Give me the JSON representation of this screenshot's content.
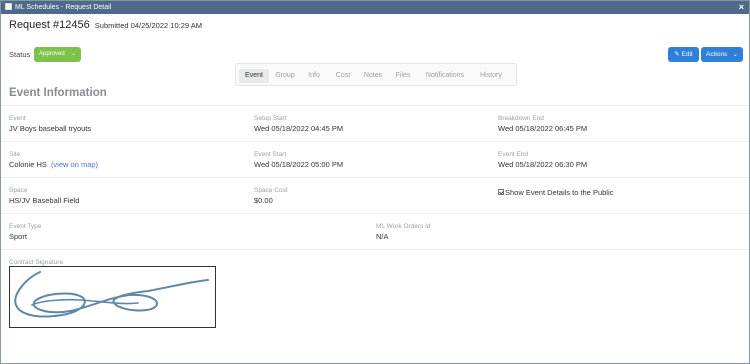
{
  "window": {
    "title": "ML Schedules - Request Detail",
    "close_label": "×"
  },
  "request": {
    "label": "Request #12456",
    "submitted": "Submitted 04/25/2022 10:29 AM"
  },
  "status": {
    "label": "Status",
    "value": "Approved",
    "color": "#7dc24b"
  },
  "actions": {
    "edit_label": "Edit",
    "actions_label": "Actions",
    "accent": "#2f80d8"
  },
  "tabs": [
    {
      "label": "Event",
      "active": true
    },
    {
      "label": "Group",
      "active": false
    },
    {
      "label": "Info",
      "active": false
    },
    {
      "label": "Cost",
      "active": false
    },
    {
      "label": "Notes",
      "active": false
    },
    {
      "label": "Files",
      "active": false
    },
    {
      "label": "Notifications",
      "active": false
    },
    {
      "label": "History",
      "active": false
    }
  ],
  "section": {
    "title": "Event Information"
  },
  "fields": {
    "event": {
      "label": "Event",
      "value": "JV Boys baseball tryouts"
    },
    "setup_start": {
      "label": "Setup Start",
      "value": "Wed 05/18/2022 04:45 PM"
    },
    "breakdown_end": {
      "label": "Breakdown End",
      "value": "Wed 05/18/2022 06:45 PM"
    },
    "site": {
      "label": "Site",
      "value": "Colonie HS",
      "link": "(view on map)"
    },
    "event_start": {
      "label": "Event Start",
      "value": "Wed 05/18/2022 05:00 PM"
    },
    "event_end": {
      "label": "Event End",
      "value": "Wed 05/18/2022 06:30 PM"
    },
    "space": {
      "label": "Space",
      "value": "HS/JV Baseball Field"
    },
    "space_cost": {
      "label": "Space Cost",
      "value": "$0.00"
    },
    "show_details": {
      "label": "Show Event Details to the Public",
      "checked": true
    },
    "event_type": {
      "label": "Event Type",
      "value": "Sport"
    },
    "work_orders": {
      "label": "ML Work Orders Id",
      "value": "N/A"
    },
    "signature": {
      "label": "Contract Signature"
    }
  }
}
